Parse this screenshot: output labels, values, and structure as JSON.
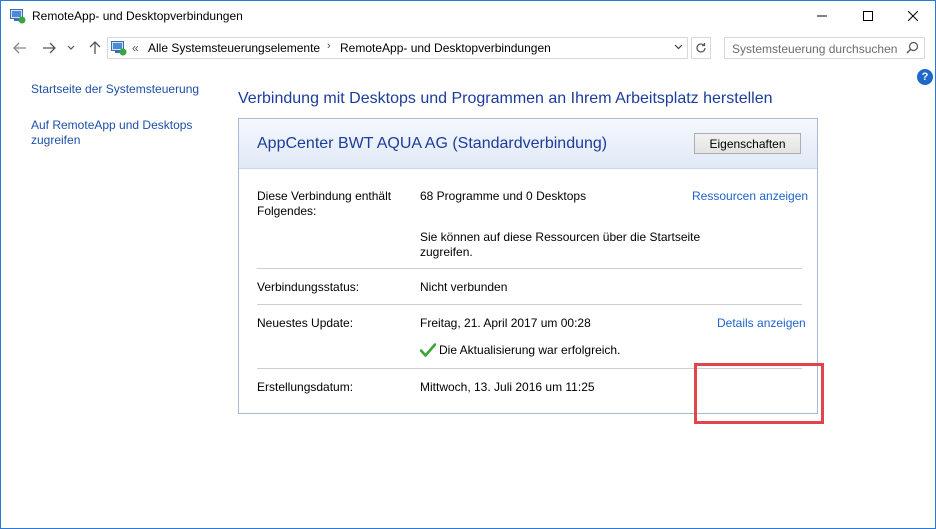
{
  "window": {
    "title": "RemoteApp- und Desktopverbindungen"
  },
  "address": {
    "overflow_chevron": "«",
    "crumbs": [
      "Alle Systemsteuerungselemente",
      "RemoteApp- und Desktopverbindungen"
    ],
    "search_placeholder": "Systemsteuerung durchsuchen"
  },
  "help": {
    "label": "?"
  },
  "sidebar": {
    "items": [
      {
        "label": "Startseite der Systemsteuerung"
      },
      {
        "label": "Auf RemoteApp und Desktops zugreifen"
      }
    ]
  },
  "main": {
    "heading": "Verbindung mit Desktops und Programmen an Ihrem Arbeitsplatz herstellen",
    "connection": {
      "name": "AppCenter BWT AQUA AG (Standardverbindung)",
      "properties_button": "Eigenschaften",
      "rows": {
        "contents_label": "Diese Verbindung enthält Folgendes:",
        "contents_value": "68 Programme und 0 Desktops",
        "contents_note": "Sie können auf diese Ressourcen über die Startseite zugreifen.",
        "contents_link": "Ressourcen anzeigen",
        "status_label": "Verbindungsstatus:",
        "status_value": "Nicht verbunden",
        "update_label": "Neuestes Update:",
        "update_value": "Freitag, 21. April 2017 um 00:28",
        "update_link": "Details anzeigen",
        "update_result": "Die Aktualisierung war erfolgreich.",
        "created_label": "Erstellungsdatum:",
        "created_value": "Mittwoch, 13. Juli 2016 um 11:25"
      }
    }
  },
  "colors": {
    "link": "#1d62c8",
    "heading": "#1c3d9a",
    "highlight_box": "#e0454b",
    "success_check": "#3aa53a"
  }
}
